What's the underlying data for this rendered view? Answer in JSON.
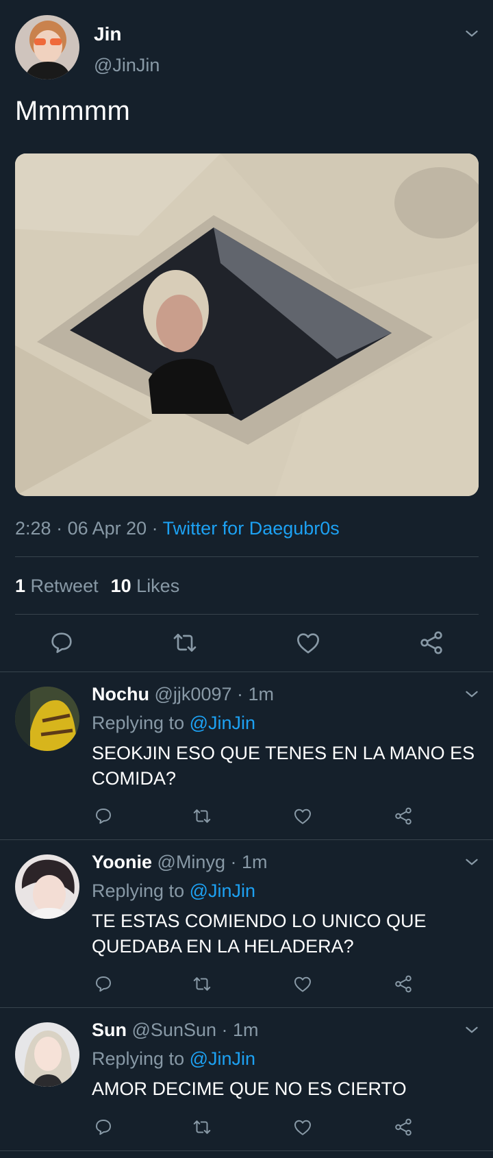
{
  "colors": {
    "background": "#15202b",
    "accent": "#1da1f2",
    "muted": "#8899a6",
    "divider": "#38444d"
  },
  "tweet": {
    "name": "Jin",
    "handle": "@JinJin",
    "text": "Mmmmm",
    "time": "2:28",
    "date": "06 Apr 20",
    "source": "Twitter for Daegubr0s",
    "retweet_count": "1",
    "retweet_label": "Retweet",
    "like_count": "10",
    "like_label": "Likes",
    "icons": [
      "reply-icon",
      "retweet-icon",
      "like-icon",
      "share-icon"
    ]
  },
  "replies": [
    {
      "name": "Nochu",
      "handle": "@jjk0097",
      "time": "1m",
      "replying_label": "Replying to",
      "mention": "@JinJin",
      "text": "SEOKJIN ESO QUE TENES EN LA MANO ES COMIDA?"
    },
    {
      "name": "Yoonie",
      "handle": "@Minyg",
      "time": "1m",
      "replying_label": "Replying to",
      "mention": "@JinJin",
      "text": "TE ESTAS COMIENDO LO UNICO QUE QUEDABA EN LA HELADERA?"
    },
    {
      "name": "Sun",
      "handle": "@SunSun",
      "time": "1m",
      "replying_label": "Replying to",
      "mention": "@JinJin",
      "text": "AMOR DECIME QUE NO ES CIERTO"
    }
  ]
}
